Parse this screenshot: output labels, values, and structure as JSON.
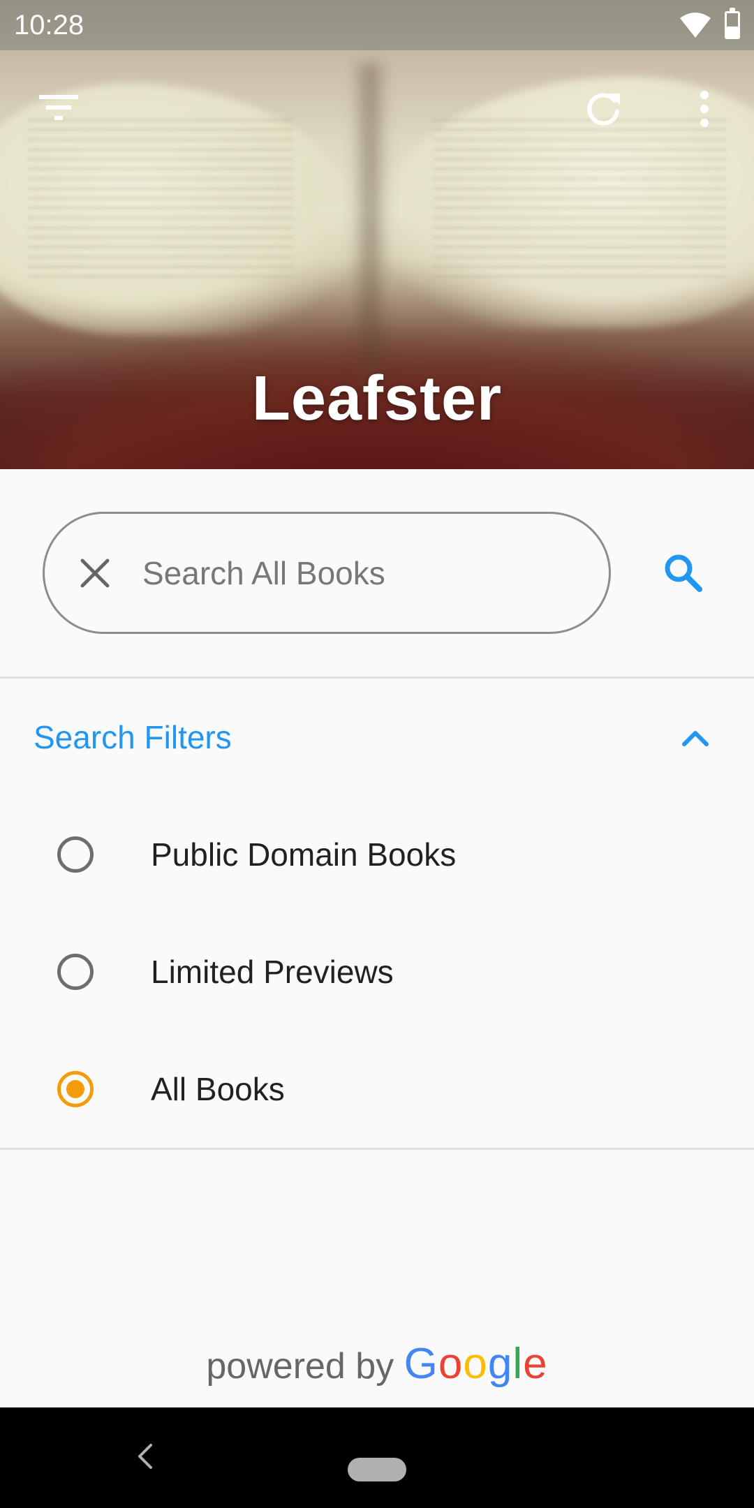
{
  "status_bar": {
    "time": "10:28"
  },
  "header": {
    "app_title": "Leafster",
    "filter_icon": "filter-list-icon",
    "refresh_icon": "refresh-icon",
    "more_icon": "more-vert-icon"
  },
  "search": {
    "placeholder": "Search All Books",
    "value": "",
    "clear_icon": "close-icon",
    "search_icon": "search-icon"
  },
  "filters": {
    "title": "Search Filters",
    "expanded": true,
    "options": [
      {
        "label": "Public Domain Books",
        "selected": false
      },
      {
        "label": "Limited Previews",
        "selected": false
      },
      {
        "label": "All Books",
        "selected": true
      }
    ]
  },
  "footer": {
    "powered_by": "powered by",
    "brand": "Google",
    "brand_colors": [
      "#4285F4",
      "#EA4335",
      "#FBBC05",
      "#4285F4",
      "#34A853",
      "#EA4335"
    ]
  },
  "colors": {
    "accent": "#2196F3",
    "radio_selected": "#F59C0C",
    "radio_unselected": "#6E6E6E"
  }
}
